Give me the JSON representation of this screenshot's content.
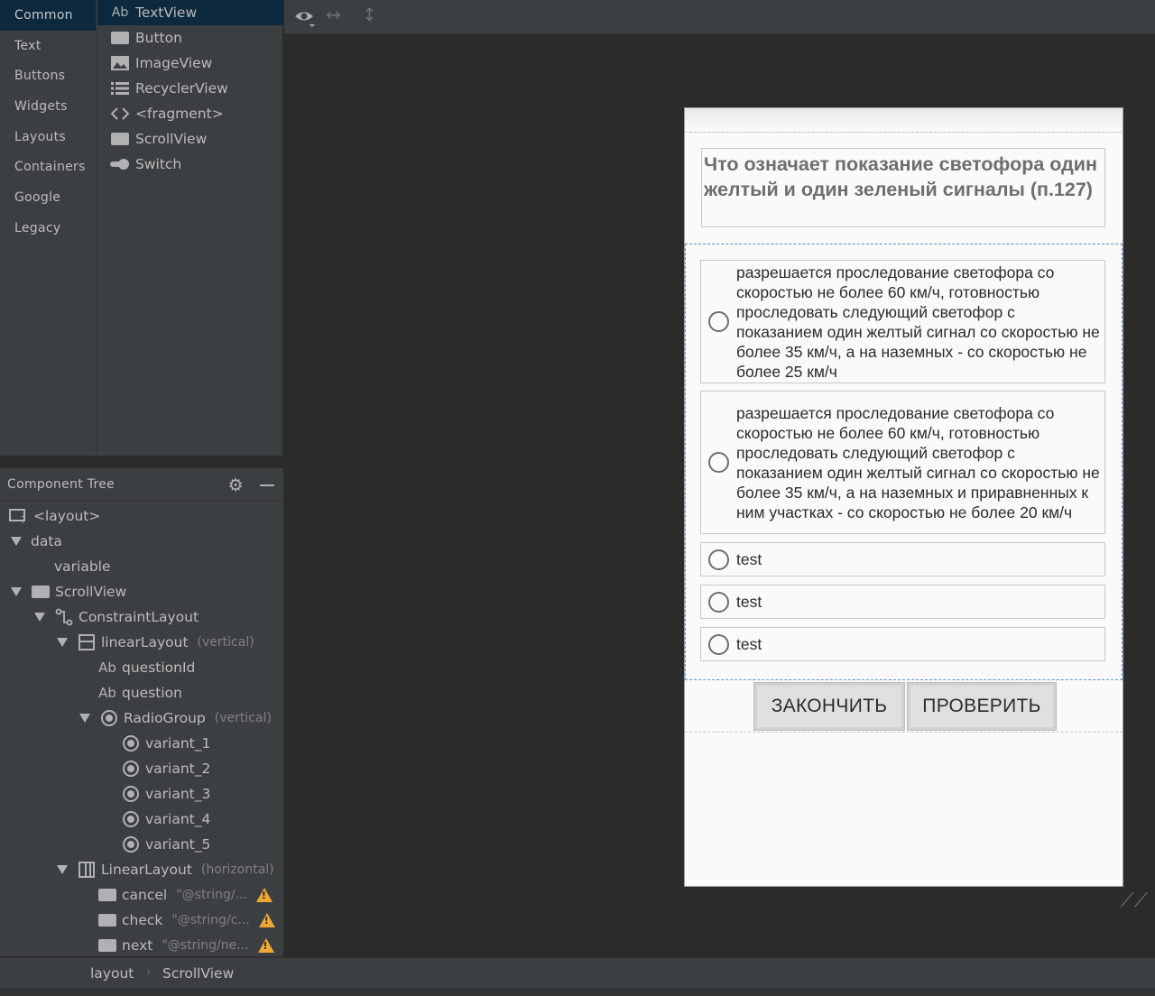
{
  "palette": {
    "categories": [
      "Common",
      "Text",
      "Buttons",
      "Widgets",
      "Layouts",
      "Containers",
      "Google",
      "Legacy"
    ],
    "components": [
      {
        "label": "TextView",
        "icon": "textview-icon"
      },
      {
        "label": "Button",
        "icon": "button-icon"
      },
      {
        "label": "ImageView",
        "icon": "image-icon"
      },
      {
        "label": "RecyclerView",
        "icon": "list-icon"
      },
      {
        "label": "<fragment>",
        "icon": "code-icon"
      },
      {
        "label": "ScrollView",
        "icon": "scrollview-icon"
      },
      {
        "label": "Switch",
        "icon": "switch-icon"
      }
    ],
    "icon_ab": "Ab"
  },
  "component_tree": {
    "title": "Component Tree",
    "nodes": {
      "layout": "<layout>",
      "data": "data",
      "variable": "variable",
      "scrollview": "ScrollView",
      "constraint": "ConstraintLayout",
      "linear_v": "linearLayout",
      "linear_v_hint": "(vertical)",
      "question_id": "questionId",
      "question": "question",
      "radio_group": "RadioGroup",
      "radio_group_hint": "(vertical)",
      "variant_1": "variant_1",
      "variant_2": "variant_2",
      "variant_3": "variant_3",
      "variant_4": "variant_4",
      "variant_5": "variant_5",
      "linear_h": "LinearLayout",
      "linear_h_hint": "(horizontal)",
      "cancel": "cancel",
      "cancel_hint": "\"@string/...",
      "check": "check",
      "check_hint": "\"@string/c...",
      "next": "next",
      "next_hint": "\"@string/ne..."
    }
  },
  "status_bar": {
    "crumbs": [
      "layout",
      "ScrollView"
    ]
  },
  "preview": {
    "question": "Что означает показание светофора один желтый и один зеленый сигналы (п.127)",
    "options": [
      "разрешается проследование светофора со скоростью не более 60 км/ч, готовностью проследовать следующий светофор с показанием один желтый сигнал со скоростью не более 35 км/ч, а на наземных - со скоростью не более 25 км/ч",
      "разрешается проследование светофора со скоростью не более 60 км/ч, готовностью проследовать следующий светофор с показанием один желтый сигнал со скоростью не более 35 км/ч, а на наземных и приравненных к ним участках - со скоростью не более 20 км/ч",
      "test",
      "test",
      "test"
    ],
    "buttons": {
      "finish": "ЗАКОНЧИТЬ",
      "check": "ПРОВЕРИТЬ"
    }
  },
  "colors": {
    "ide_background": "#2b2b2b",
    "panel": "#3c3f41",
    "selection": "#0d293e",
    "warning": "#f0a732",
    "blueprint_border": "#5b8fd6"
  }
}
